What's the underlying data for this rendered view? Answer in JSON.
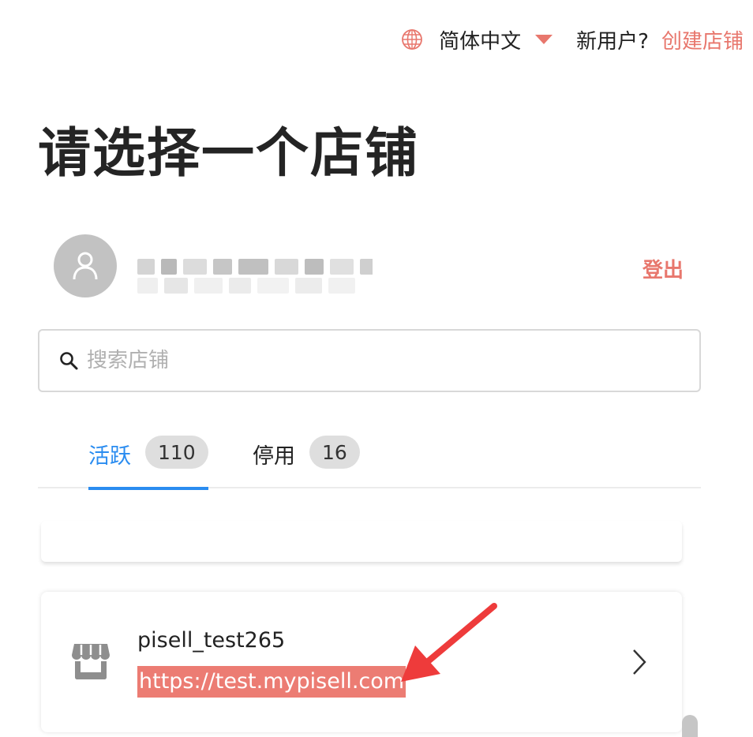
{
  "header": {
    "language": "简体中文",
    "new_user_text": "新用户?",
    "create_store_link": "创建店铺"
  },
  "page_title": "请选择一个店铺",
  "user": {
    "logout_label": "登出"
  },
  "search": {
    "placeholder": "搜索店铺",
    "value": ""
  },
  "tabs": [
    {
      "label": "活跃",
      "count": "110",
      "active": true
    },
    {
      "label": "停用",
      "count": "16",
      "active": false
    }
  ],
  "stores": [
    {
      "name": "pisell_test265",
      "url": "https://test.mypisell.com"
    }
  ],
  "colors": {
    "accent": "#e8776d",
    "tab_active": "#2a8cf0",
    "highlight": "#ec7c73",
    "arrow": "#ee3b3b"
  },
  "icons": [
    "globe-icon",
    "caret-down-icon",
    "user-icon",
    "search-icon",
    "store-icon",
    "chevron-right-icon",
    "annotation-arrow-icon"
  ]
}
